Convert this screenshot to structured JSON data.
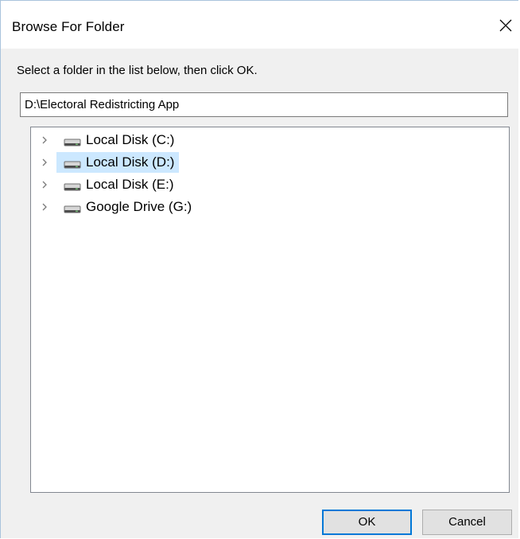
{
  "window": {
    "title": "Browse For Folder",
    "close_icon": "close-icon"
  },
  "prompt": "Select a folder in the list below, then click OK.",
  "path": {
    "value": "D:\\Electoral Redistricting App"
  },
  "tree": {
    "items": [
      {
        "label": "Local Disk (C:)",
        "icon": "drive-icon",
        "selected": false
      },
      {
        "label": "Local Disk (D:)",
        "icon": "drive-icon",
        "selected": true
      },
      {
        "label": "Local Disk (E:)",
        "icon": "drive-icon",
        "selected": false
      },
      {
        "label": "Google Drive (G:)",
        "icon": "drive-icon",
        "selected": false
      }
    ]
  },
  "buttons": {
    "ok_label": "OK",
    "cancel_label": "Cancel"
  },
  "colors": {
    "selection": "#cce8ff",
    "accent": "#0078d7",
    "dialog_bg": "#f0f0f0"
  }
}
